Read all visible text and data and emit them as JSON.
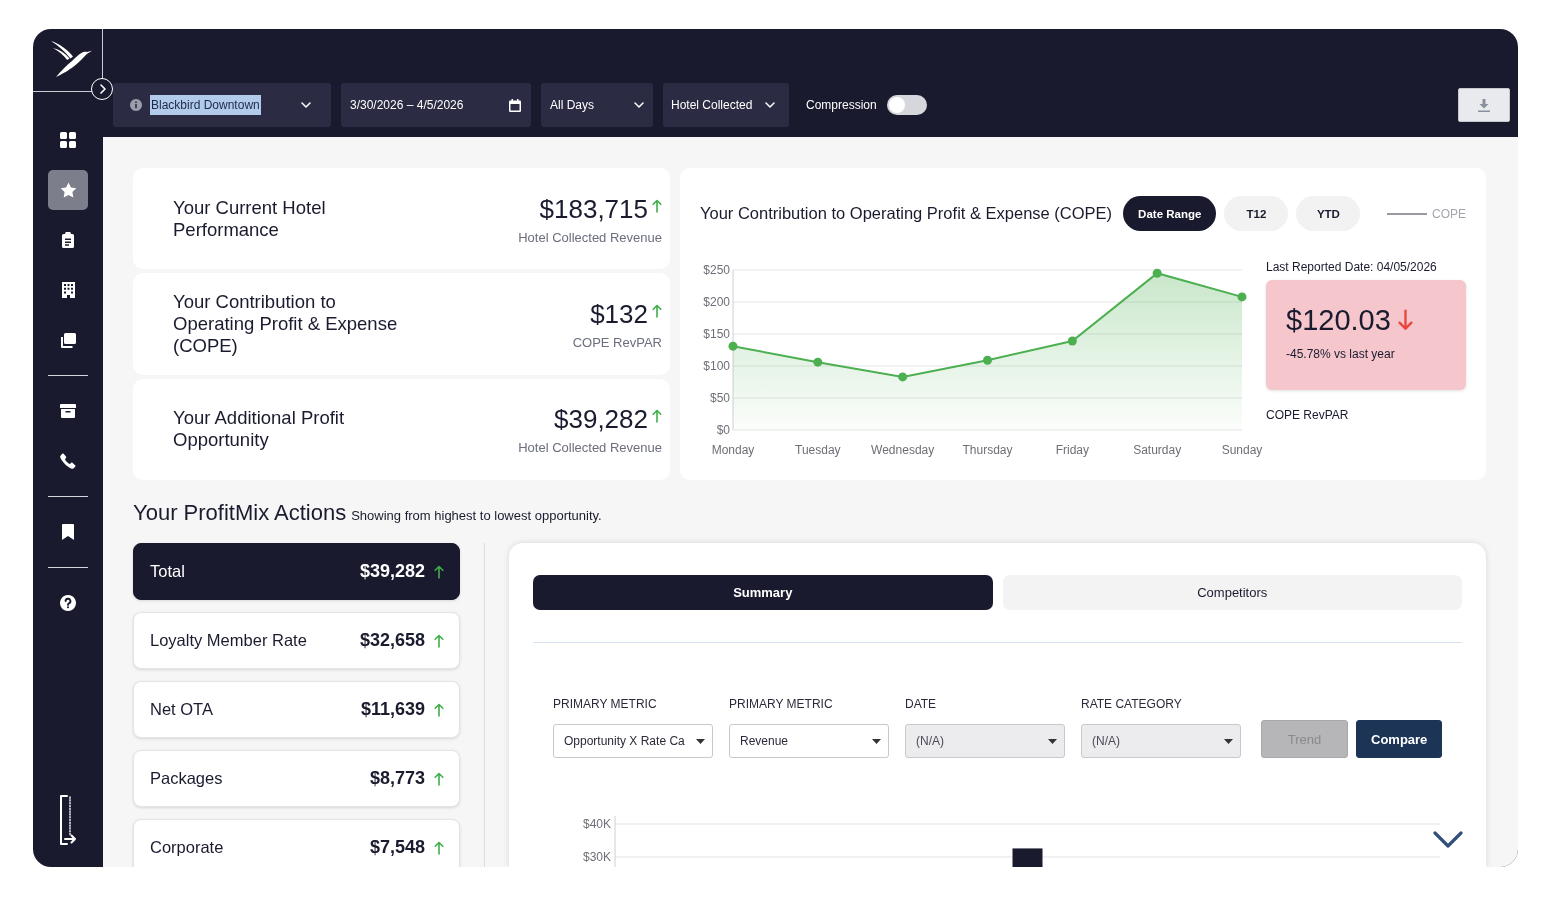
{
  "sidebar": {
    "groups": [
      {
        "items": [
          {
            "kind": "dashboard",
            "selected": false
          },
          {
            "kind": "favorites",
            "selected": true
          },
          {
            "kind": "reports",
            "selected": false
          },
          {
            "kind": "properties",
            "selected": false
          },
          {
            "kind": "documents",
            "selected": false
          }
        ]
      },
      {
        "items": [
          {
            "kind": "archive",
            "selected": false
          },
          {
            "kind": "contacts",
            "selected": false
          }
        ]
      },
      {
        "items": [
          {
            "kind": "bookmarks",
            "selected": false
          }
        ]
      },
      {
        "items": [
          {
            "kind": "help",
            "selected": false
          }
        ]
      }
    ]
  },
  "header": {
    "property": {
      "value": "Blackbird Downtown",
      "highlighted": true
    },
    "date_range": {
      "value": "3/30/2026 – 4/5/2026"
    },
    "days": {
      "value": "All Days"
    },
    "revenue_source": {
      "value": "Hotel Collected"
    },
    "compression": {
      "label": "Compression",
      "on": false
    }
  },
  "summary_cards": [
    {
      "title": "Your Current Hotel Performance",
      "value": "$183,715",
      "increase": true,
      "caption": "Hotel Collected Revenue"
    },
    {
      "title": "Your Contribution to Operating Profit & Expense (COPE)",
      "value": "$132",
      "increase": true,
      "caption": "COPE RevPAR"
    },
    {
      "title": "Your Additional Profit Opportunity",
      "value": "$39,282",
      "increase": true,
      "caption": "Hotel Collected Revenue"
    }
  ],
  "cope_panel": {
    "title": "Your Contribution to Operating Profit & Expense (COPE)",
    "periods": [
      {
        "label": "Date Range",
        "selected": true
      },
      {
        "label": "T12",
        "selected": false
      },
      {
        "label": "YTD",
        "selected": false
      }
    ],
    "chart_data": {
      "type": "area",
      "grid": true,
      "categories": [
        "Monday",
        "Tuesday",
        "Wednesday",
        "Thursday",
        "Friday",
        "Saturday",
        "Sunday"
      ],
      "series": [
        {
          "name": "COPE",
          "color": "#4caf50",
          "values": [
            131,
            106,
            83,
            109,
            139,
            245,
            208
          ]
        }
      ],
      "ylim": [
        0,
        250
      ],
      "yticks": [
        {
          "value": 0,
          "label": "$0"
        },
        {
          "value": 50,
          "label": "$50"
        },
        {
          "value": 100,
          "label": "$100"
        },
        {
          "value": 150,
          "label": "$150"
        },
        {
          "value": 200,
          "label": "$200"
        },
        {
          "value": 250,
          "label": "$250"
        }
      ]
    },
    "last_reported": "Last Reported Date: 04/05/2026",
    "kpi": {
      "value": "$120.03",
      "increase": false,
      "change": "-45.78% vs last year"
    },
    "kpi_caption": "COPE RevPAR"
  },
  "profitmix": {
    "title": "Your ProfitMix Actions",
    "subtitle": "Showing from highest to lowest opportunity.",
    "actions": [
      {
        "label": "Total",
        "value": "$39,282",
        "increase": true,
        "selected": true
      },
      {
        "label": "Loyalty Member Rate",
        "value": "$32,658",
        "increase": true,
        "selected": false
      },
      {
        "label": "Net OTA",
        "value": "$11,639",
        "increase": true,
        "selected": false
      },
      {
        "label": "Packages",
        "value": "$8,773",
        "increase": true,
        "selected": false
      },
      {
        "label": "Corporate",
        "value": "$7,548",
        "increase": true,
        "selected": false
      }
    ],
    "detail": {
      "tabs": [
        {
          "label": "Summary",
          "selected": true
        },
        {
          "label": "Competitors",
          "selected": false
        }
      ],
      "filters": [
        {
          "label": "PRIMARY METRIC",
          "value": "Opportunity X Rate Ca",
          "disabled": false
        },
        {
          "label": "PRIMARY METRIC",
          "value": "Revenue",
          "disabled": false
        },
        {
          "label": "DATE",
          "value": "(N/A)",
          "disabled": true
        },
        {
          "label": "RATE CATEGORY",
          "value": "(N/A)",
          "disabled": true
        }
      ],
      "buttons": [
        {
          "label": "Trend",
          "disabled": true
        },
        {
          "label": "Compare",
          "disabled": false
        }
      ],
      "chart_data": {
        "type": "bar",
        "grid": true,
        "ylim": [
          0,
          40000
        ],
        "yticks": [
          {
            "value": 30000,
            "label": "$30K"
          },
          {
            "value": 40000,
            "label": "$40K"
          }
        ],
        "values": [
          32600
        ]
      }
    }
  }
}
